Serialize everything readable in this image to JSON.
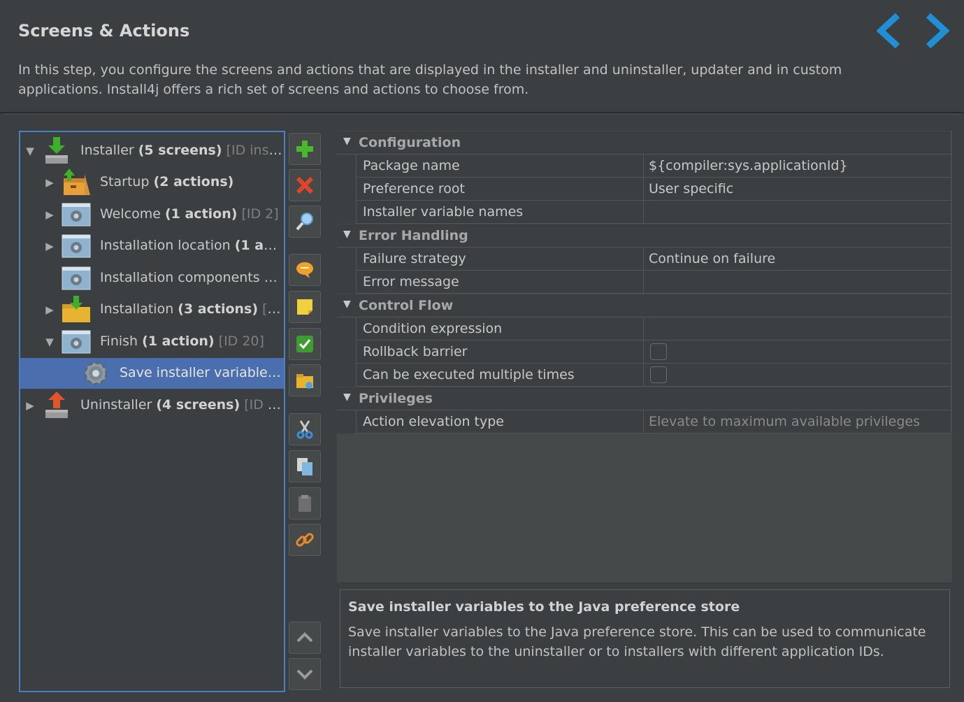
{
  "header": {
    "title": "Screens & Actions",
    "description": "In this step, you configure the screens and actions that are displayed in the installer and uninstaller, updater and in custom applications. Install4j offers a rich set of screens and actions to choose from."
  },
  "nav": {
    "back_icon": "chevron-left-icon",
    "next_icon": "chevron-right-icon",
    "accent": "#1f8fd6"
  },
  "tree": {
    "installer": {
      "name": "Installer",
      "count": "(5 screens)",
      "id": "[ID instal..."
    },
    "startup": {
      "name": "Startup",
      "count": "(2 actions)"
    },
    "welcome": {
      "name": "Welcome",
      "count": "(1 action)",
      "id": "[ID 2]"
    },
    "location": {
      "name": "Installation location",
      "count": "(1 ac..."
    },
    "components": {
      "name": "Installation components",
      "id": "[I..."
    },
    "installation": {
      "name": "Installation",
      "count": "(3 actions)",
      "id": "[I..."
    },
    "finish": {
      "name": "Finish",
      "count": "(1 action)",
      "id": "[ID 20]"
    },
    "save_vars": {
      "name": "Save installer variables ..."
    },
    "uninstaller": {
      "name": "Uninstaller",
      "count": "(4 screens)",
      "id": "[ID un..."
    }
  },
  "toolbar": {
    "add": "plus-icon",
    "remove": "delete-icon",
    "search": "magnifier-icon",
    "comment": "comment-icon",
    "note": "note-icon",
    "enable": "check-icon",
    "folder": "folder-icon",
    "cut": "scissors-icon",
    "copy": "copy-icon",
    "paste": "paste-icon",
    "link": "link-icon",
    "up": "up-icon",
    "down": "down-icon"
  },
  "properties": {
    "configuration": {
      "title": "Configuration",
      "package_name": {
        "label": "Package name",
        "value": "${compiler:sys.applicationId}"
      },
      "preference_root": {
        "label": "Preference root",
        "value": "User specific"
      },
      "variable_names": {
        "label": "Installer variable names",
        "value": ""
      }
    },
    "error_handling": {
      "title": "Error Handling",
      "failure_strategy": {
        "label": "Failure strategy",
        "value": "Continue on failure"
      },
      "error_message": {
        "label": "Error message",
        "value": ""
      }
    },
    "control_flow": {
      "title": "Control Flow",
      "condition": {
        "label": "Condition expression",
        "value": ""
      },
      "rollback": {
        "label": "Rollback barrier",
        "checked": false
      },
      "multiple": {
        "label": "Can be executed multiple times",
        "checked": false
      }
    },
    "privileges": {
      "title": "Privileges",
      "elevation": {
        "label": "Action elevation type",
        "value": "Elevate to maximum available privileges"
      }
    }
  },
  "description": {
    "title": "Save installer variables to the Java preference store",
    "text": "Save installer variables to the Java preference store. This can be used to communicate installer variables to the uninstaller or to installers with different application IDs."
  }
}
